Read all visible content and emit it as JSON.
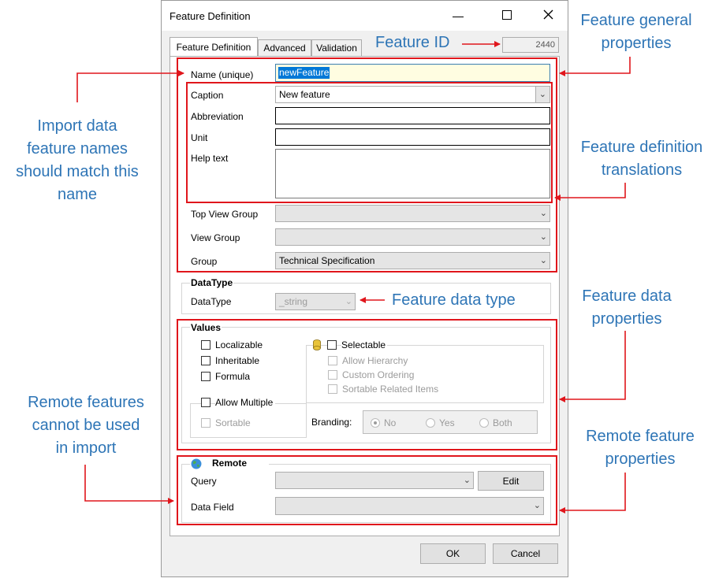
{
  "window": {
    "title": "Feature Definition"
  },
  "tabs": [
    {
      "label": "Feature Definition",
      "selected": true
    },
    {
      "label": "Advanced",
      "selected": false
    },
    {
      "label": "Validation",
      "selected": false
    }
  ],
  "feature_id_value": "2440",
  "general": {
    "name_label": "Name (unique)",
    "name_value": "newFeature",
    "caption_label": "Caption",
    "caption_value": "New feature",
    "abbreviation_label": "Abbreviation",
    "unit_label": "Unit",
    "help_text_label": "Help text",
    "top_view_group_label": "Top View Group",
    "view_group_label": "View Group",
    "group_label": "Group",
    "group_value": "Technical Specification"
  },
  "datatype": {
    "section_label": "DataType",
    "label": "DataType",
    "value": "_string"
  },
  "values": {
    "section_label": "Values",
    "localizable": "Localizable",
    "inheritable": "Inheritable",
    "formula": "Formula",
    "selectable": "Selectable",
    "allow_hierarchy": "Allow Hierarchy",
    "custom_ordering": "Custom Ordering",
    "sortable_related": "Sortable Related Items",
    "allow_multiple": "Allow Multiple",
    "sortable": "Sortable",
    "branding_label": "Branding:",
    "branding_options": [
      "No",
      "Yes",
      "Both"
    ],
    "branding_selected": "No"
  },
  "remote": {
    "section_label": "Remote",
    "query_label": "Query",
    "edit_button": "Edit",
    "data_field_label": "Data Field"
  },
  "buttons": {
    "ok": "OK",
    "cancel": "Cancel"
  },
  "annotations": {
    "general_line1": "Feature general",
    "general_line2": "properties",
    "feature_id": "Feature ID",
    "import_line1": "Import data",
    "import_line2": "feature names",
    "import_line3": "should match this",
    "import_line4": "name",
    "translations_line1": "Feature definition",
    "translations_line2": "translations",
    "data_type": "Feature data type",
    "data_props_line1": "Feature data",
    "data_props_line2": "properties",
    "remote_import_line1": "Remote features",
    "remote_import_line2": "cannot be used",
    "remote_import_line3": "in import",
    "remote_props_line1": "Remote feature",
    "remote_props_line2": "properties"
  },
  "colors": {
    "annotation_blue": "#2E75B6",
    "annotation_red": "#E0161C"
  }
}
